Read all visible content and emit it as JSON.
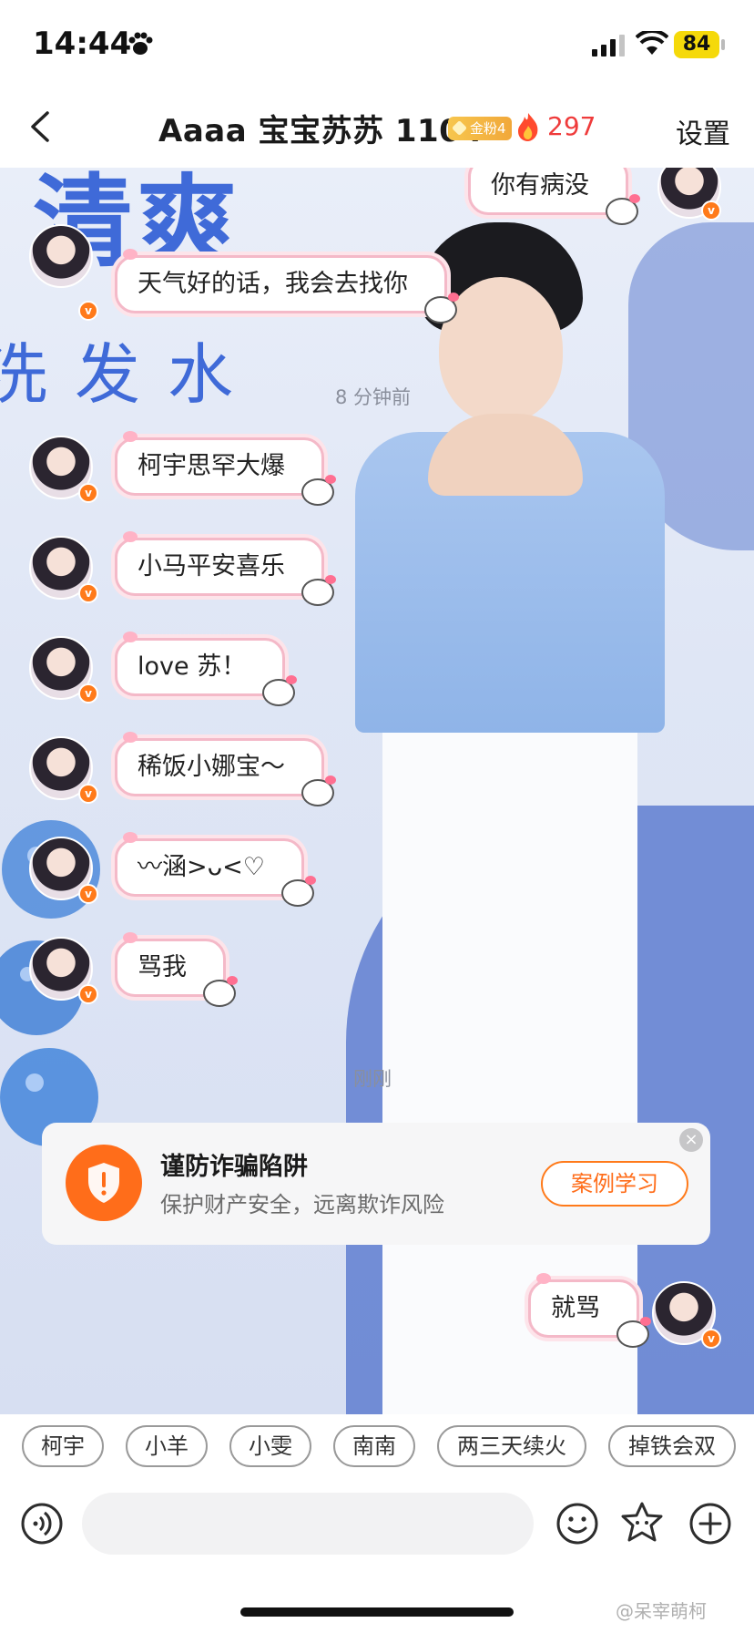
{
  "status_bar": {
    "time": "14:44",
    "battery": "84"
  },
  "header": {
    "title": "Aaaa 宝宝苏苏 1104",
    "fan_badge": "金粉4",
    "fire_count": "297",
    "settings_label": "设置"
  },
  "background": {
    "text_top": "清爽",
    "text_side": "洗发水"
  },
  "timestamps": [
    "8 分钟前",
    "刚刚"
  ],
  "messages": [
    {
      "text": "你有病没"
    },
    {
      "text": "天气好的话，我会去找你"
    },
    {
      "text": "柯宇思罕大爆"
    },
    {
      "text": "小马平安喜乐"
    },
    {
      "text": "love 苏！"
    },
    {
      "text": "稀饭小娜宝～"
    },
    {
      "text": "〰涵>ᴗ<♡"
    },
    {
      "text": "骂我"
    },
    {
      "text": "就骂"
    }
  ],
  "fraud_banner": {
    "title": "谨防诈骗陷阱",
    "subtitle": "保护财产安全，远离欺诈风险",
    "button": "案例学习",
    "close": "×"
  },
  "quick_replies": [
    "柯宇",
    "小羊",
    "小雯",
    "南南",
    "两三天续火",
    "掉铁会双"
  ],
  "input": {
    "placeholder": ""
  },
  "watermark": "@呆宰萌柯",
  "colors": {
    "accent": "#ff6d1a",
    "fire": "#ef3b3b",
    "bubble_border": "#f4b9c8"
  }
}
